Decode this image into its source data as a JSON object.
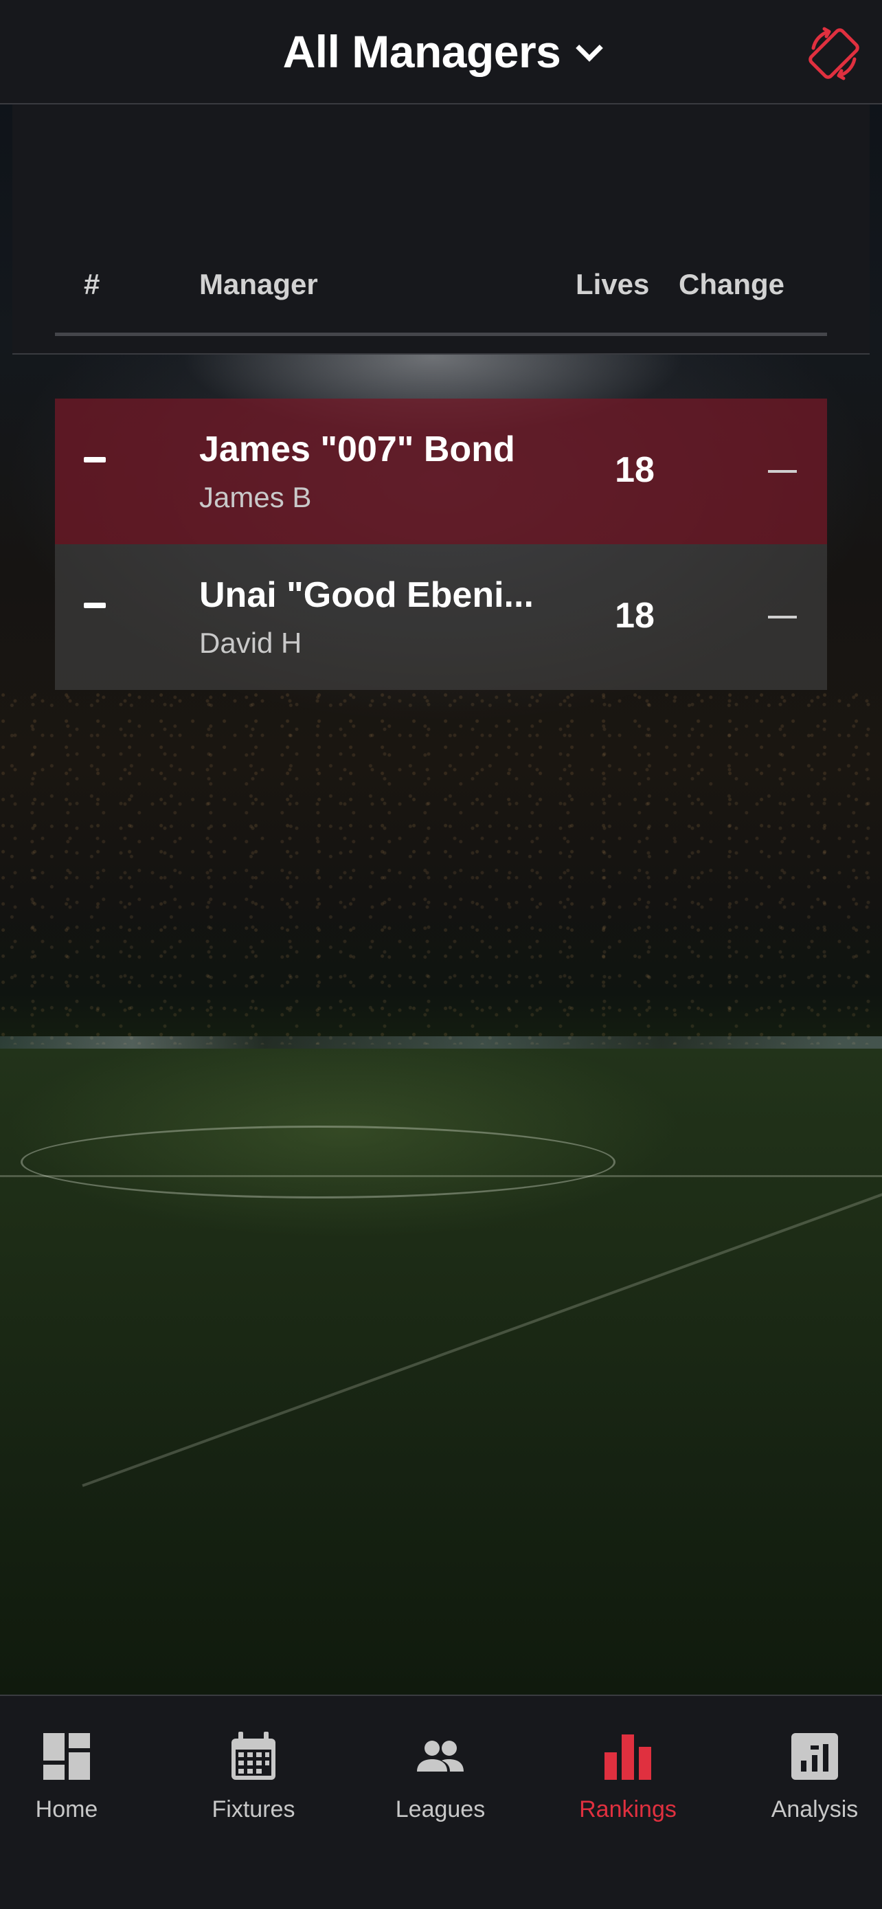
{
  "header": {
    "title": "All Managers",
    "dropdown_icon": "chevron-down-icon",
    "rotate_icon": "screen-rotation-icon",
    "accent_color": "#e0303f"
  },
  "table": {
    "columns": {
      "rank": "#",
      "manager": "Manager",
      "lives": "Lives",
      "change": "Change"
    },
    "rows": [
      {
        "rank": "–",
        "name": "James \"007\" Bond",
        "user": "James B",
        "lives": "18",
        "change": "—",
        "highlight_color": "#701826"
      },
      {
        "rank": "–",
        "name": "Unai \"Good Ebeni...",
        "user": "David H",
        "lives": "18",
        "change": "—",
        "highlight_color": "#484848"
      }
    ]
  },
  "tabbar": {
    "items": [
      {
        "label": "Home",
        "icon": "dashboard-icon",
        "active": false
      },
      {
        "label": "Fixtures",
        "icon": "calendar-icon",
        "active": false
      },
      {
        "label": "Leagues",
        "icon": "people-icon",
        "active": false
      },
      {
        "label": "Rankings",
        "icon": "bar-chart-icon",
        "active": true
      },
      {
        "label": "Analysis",
        "icon": "analytics-icon",
        "active": false
      }
    ],
    "active_color": "#e0303f",
    "inactive_color": "#c8c8c8"
  }
}
